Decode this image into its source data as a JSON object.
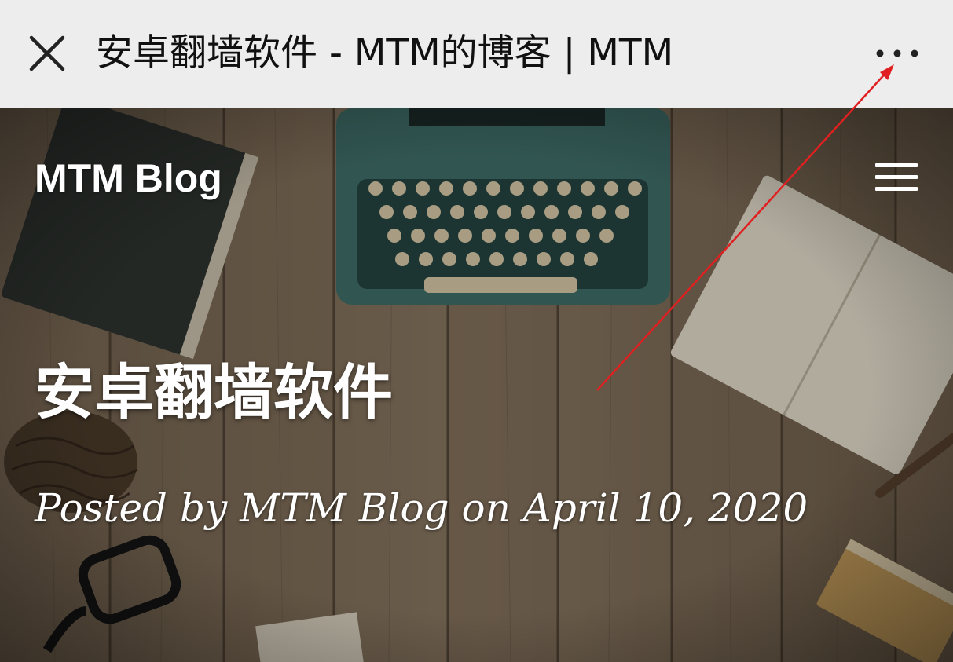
{
  "topbar": {
    "page_title": "安卓翻墙软件 - MTM的博客 | MTM",
    "close_icon": "close-icon",
    "more_icon": "more-horizontal-icon"
  },
  "hero": {
    "brand": "MTM Blog",
    "menu_icon": "hamburger-menu-icon",
    "title": "安卓翻墙软件",
    "meta": "Posted by MTM Blog on April 10, 2020"
  },
  "colors": {
    "topbar_bg": "#ededed",
    "annotation_arrow": "#e02020",
    "hero_text": "#ffffff"
  }
}
